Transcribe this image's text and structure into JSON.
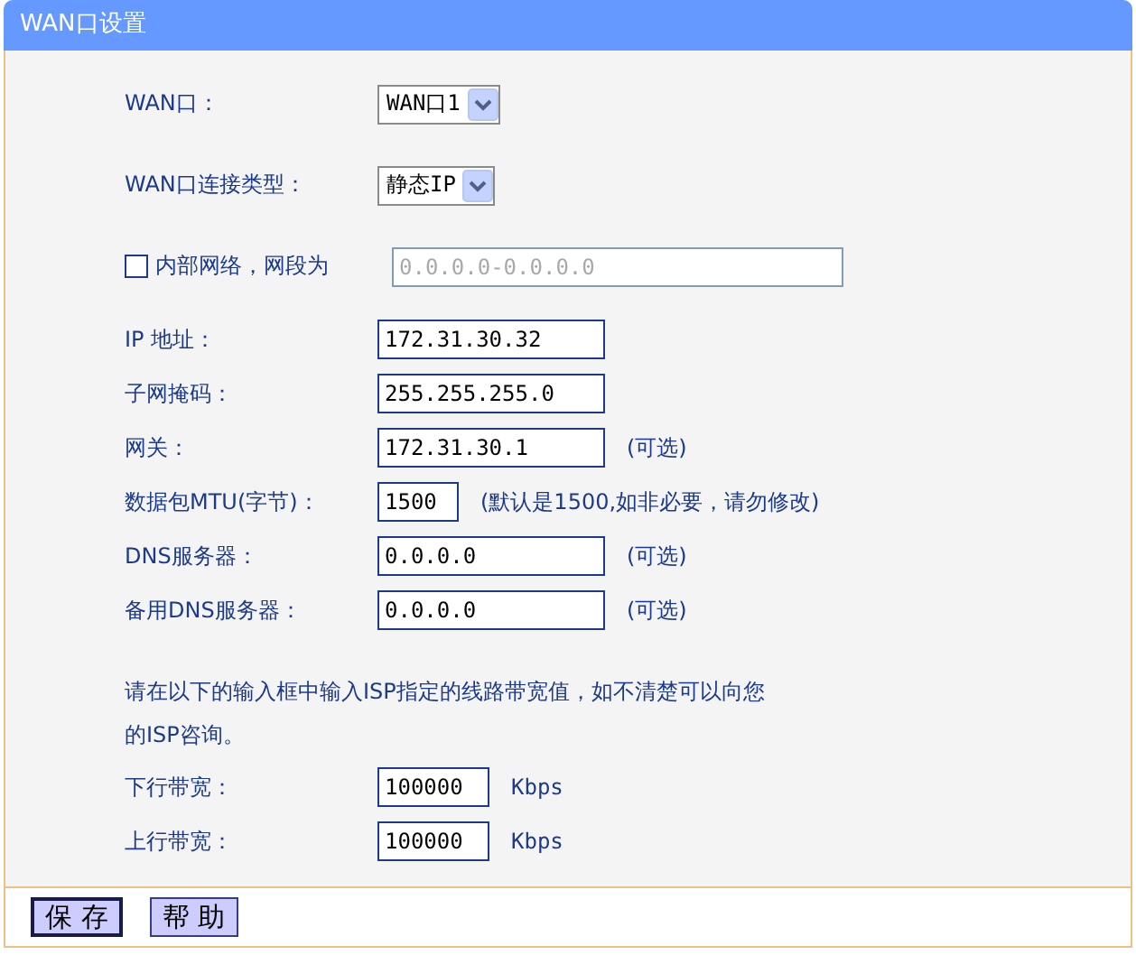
{
  "title": "WAN口设置",
  "sections": [
    {
      "rows": [
        {
          "kind": "select",
          "label": "WAN口：",
          "value": "WAN口1"
        },
        {
          "kind": "select",
          "label": "WAN口连接类型：",
          "value": "静态IP"
        },
        {
          "kind": "check",
          "label": "内部网络，网段为",
          "checked": false,
          "value": "0.0.0.0-0.0.0.0",
          "disabled": true
        }
      ]
    },
    {
      "rows": [
        {
          "kind": "field",
          "label": "IP 地址：",
          "value": "172.31.30.32"
        },
        {
          "kind": "field",
          "label": "子网掩码：",
          "value": "255.255.255.0"
        },
        {
          "kind": "field",
          "label": "网关：",
          "value": "172.31.30.1",
          "note": "(可选)"
        },
        {
          "kind": "short-field",
          "label": "数据包MTU(字节)：",
          "value": "1500",
          "note": "(默认是1500,如非必要，请勿修改)"
        },
        {
          "kind": "field",
          "label": "DNS服务器：",
          "value": "0.0.0.0",
          "note": "(可选)"
        },
        {
          "kind": "field",
          "label": "备用DNS服务器：",
          "value": "0.0.0.0",
          "note": "(可选)"
        }
      ]
    },
    {
      "note": "请在以下的输入框中输入ISP指定的线路带宽值，如不清楚可以向您的ISP咨询。",
      "rows": [
        {
          "kind": "rate-field",
          "label": "下行带宽：",
          "value": "100000",
          "note": "Kbps"
        },
        {
          "kind": "rate-field",
          "label": "上行带宽：",
          "value": "100000",
          "note": "Kbps"
        }
      ]
    }
  ],
  "buttons": [
    {
      "label": "保 存",
      "focused": true
    },
    {
      "label": "帮 助",
      "focused": false
    }
  ]
}
